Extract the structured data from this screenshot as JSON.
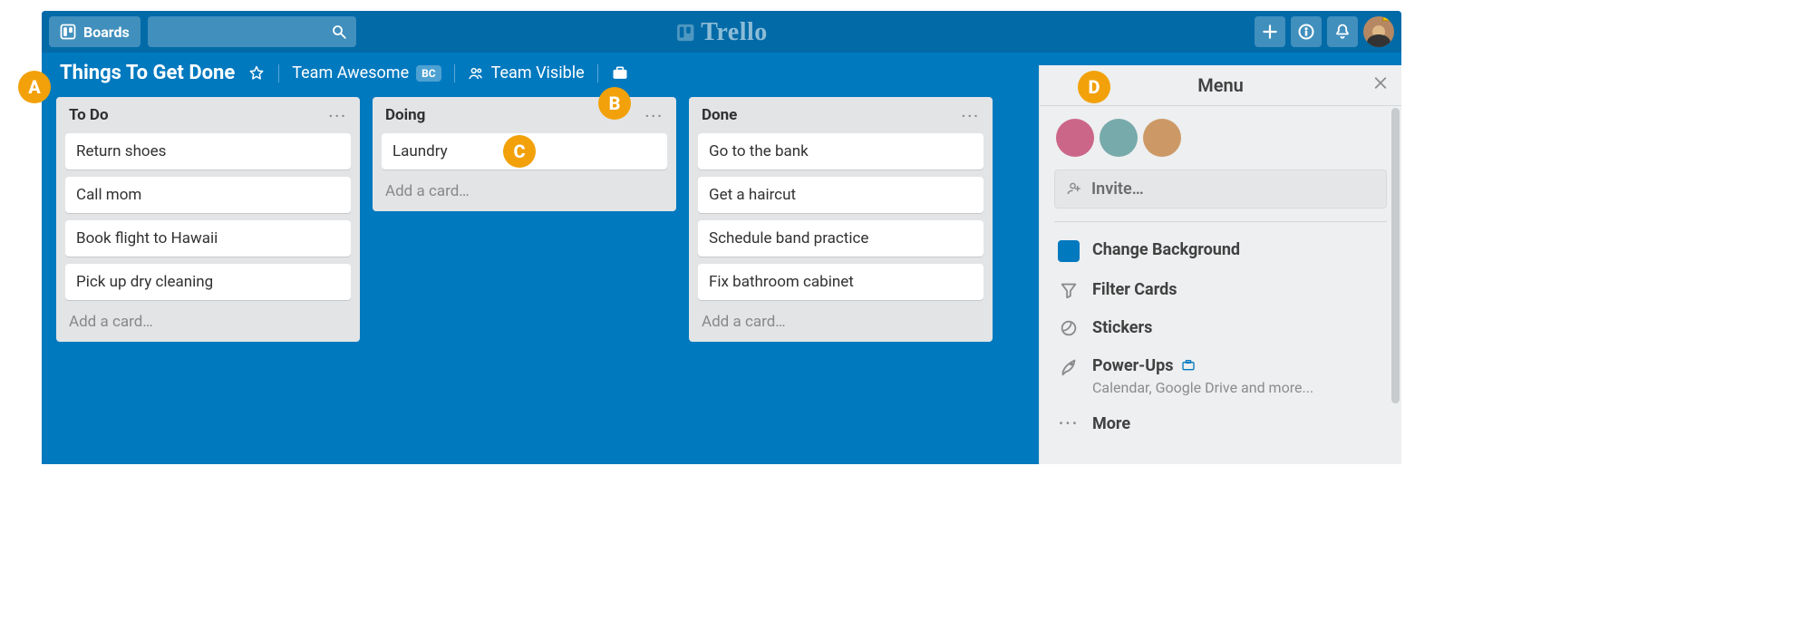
{
  "topbar": {
    "boards_label": "Boards",
    "logo_text": "Trello"
  },
  "board": {
    "title": "Things To Get Done",
    "team_name": "Team Awesome",
    "team_badge": "BC",
    "visibility": "Team Visible"
  },
  "lists": [
    {
      "title": "To Do",
      "cards": [
        "Return shoes",
        "Call mom",
        "Book flight to Hawaii",
        "Pick up dry cleaning"
      ],
      "add_label": "Add a card…"
    },
    {
      "title": "Doing",
      "cards": [
        "Laundry"
      ],
      "add_label": "Add a card…"
    },
    {
      "title": "Done",
      "cards": [
        "Go to the bank",
        "Get a haircut",
        "Schedule band practice",
        "Fix bathroom cabinet"
      ],
      "add_label": "Add a card…"
    }
  ],
  "menu": {
    "title": "Menu",
    "invite_label": "Invite…",
    "items": {
      "change_bg": "Change Background",
      "filter": "Filter Cards",
      "stickers": "Stickers",
      "powerups": "Power-Ups",
      "powerups_sub": "Calendar, Google Drive and more...",
      "more": "More"
    }
  },
  "annotations": {
    "a": "A",
    "b": "B",
    "c": "C",
    "d": "D"
  }
}
